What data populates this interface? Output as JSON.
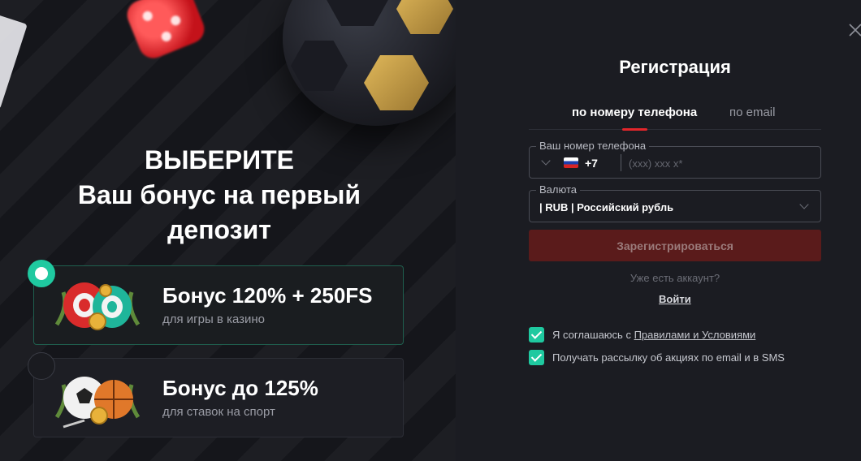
{
  "promo": {
    "headline_line1": "ВЫБЕРИТЕ",
    "headline_line2": "Ваш бонус на первый",
    "headline_line3": "депозит",
    "bonuses": [
      {
        "title": "Бонус 120% + 250FS",
        "subtitle": "для игры в казино",
        "selected": true
      },
      {
        "title": "Бонус до 125%",
        "subtitle": "для ставок на спорт",
        "selected": false
      }
    ]
  },
  "form": {
    "title": "Регистрация",
    "tabs": [
      {
        "label": "по номеру телефона",
        "active": true
      },
      {
        "label": "по email",
        "active": false
      }
    ],
    "phone": {
      "label": "Ваш номер телефона",
      "country_code": "+7",
      "placeholder": "(xxx) xxx x*"
    },
    "currency": {
      "label": "Валюта",
      "value": "| RUB | Российский рубль"
    },
    "register_label": "Зарегистрироваться",
    "have_account": "Уже есть аккаунт?",
    "login_label": "Войти",
    "checkboxes": [
      {
        "prefix": "Я соглашаюсь с ",
        "link": "Правилами и Условиями",
        "checked": true
      },
      {
        "text": "Получать рассылку об акциях по email и в SMS",
        "checked": true
      }
    ]
  },
  "colors": {
    "accent_green": "#1fc9a0",
    "accent_red": "#e3262b",
    "register_bg": "#5a1b1b",
    "background": "#1b1c22"
  },
  "icons": [
    "close-icon",
    "russia-flag-icon",
    "chevron-down-icon",
    "casino-chips-icon",
    "sports-balls-icon",
    "checkmark-icon"
  ]
}
